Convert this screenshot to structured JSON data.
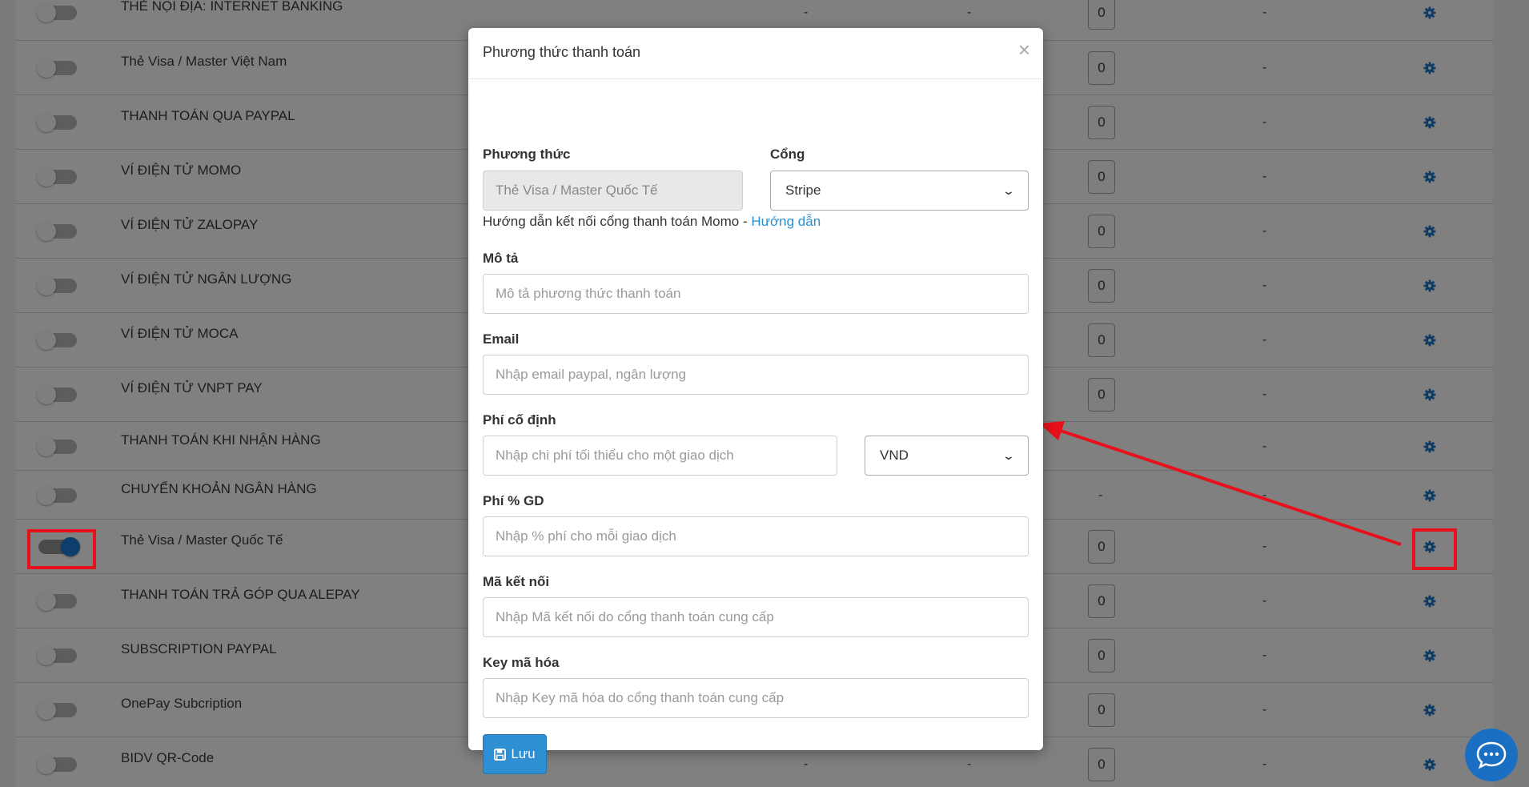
{
  "background": {
    "rows": [
      {
        "name": "THẺ NỘI ĐỊA: INTERNET BANKING",
        "col3": "-",
        "col4": "-",
        "box": "0",
        "col6": "-",
        "toggle_on": false
      },
      {
        "name": "Thẻ Visa / Master Việt Nam",
        "col3": "",
        "col4": "",
        "box": "0",
        "col6": "-",
        "toggle_on": false
      },
      {
        "name": "THANH TOÁN QUA PAYPAL",
        "col3": "",
        "col4": "",
        "box": "0",
        "col6": "-",
        "toggle_on": false
      },
      {
        "name": "VÍ ĐIỆN TỬ MOMO",
        "col3": "",
        "col4": "",
        "box": "0",
        "col6": "-",
        "toggle_on": false
      },
      {
        "name": "VÍ ĐIỆN TỬ ZALOPAY",
        "col3": "",
        "col4": "",
        "box": "0",
        "col6": "-",
        "toggle_on": false
      },
      {
        "name": "VÍ ĐIỆN TỬ NGÂN LƯỢNG",
        "col3": "",
        "col4": "",
        "box": "0",
        "col6": "-",
        "toggle_on": false
      },
      {
        "name": "VÍ ĐIỆN TỬ MOCA",
        "col3": "",
        "col4": "",
        "box": "0",
        "col6": "-",
        "toggle_on": false
      },
      {
        "name": "VÍ ĐIỆN TỬ VNPT PAY",
        "col3": "",
        "col4": "",
        "box": "0",
        "col6": "-",
        "toggle_on": false
      },
      {
        "name": "THANH TOÁN KHI NHẬN HÀNG",
        "col3": "",
        "col4": "",
        "box": "",
        "col6": "-",
        "toggle_on": false
      },
      {
        "name": "CHUYỂN KHOẢN NGÂN HÀNG",
        "col3": "",
        "col4": "",
        "box": "-",
        "col6": "-",
        "toggle_on": false
      },
      {
        "name": "Thẻ Visa / Master Quốc Tế",
        "col3": "",
        "col4": "",
        "box": "0",
        "col6": "-",
        "toggle_on": true
      },
      {
        "name": "THANH TOÁN TRẢ GÓP QUA ALEPAY",
        "col3": "",
        "col4": "",
        "box": "0",
        "col6": "-",
        "toggle_on": false
      },
      {
        "name": "SUBSCRIPTION PAYPAL",
        "col3": "",
        "col4": "",
        "box": "0",
        "col6": "-",
        "toggle_on": false
      },
      {
        "name": "OnePay Subcription",
        "col3": "",
        "col4": "",
        "box": "0",
        "col6": "-",
        "toggle_on": false
      },
      {
        "name": "BIDV QR-Code",
        "col3": "-",
        "col4": "-",
        "box": "0",
        "col6": "-",
        "toggle_on": false
      }
    ]
  },
  "modal": {
    "title": "Phương thức thanh toán",
    "close_symbol": "×",
    "method": {
      "label": "Phương thức",
      "value": "Thẻ Visa / Master Quốc Tế"
    },
    "gateway": {
      "label": "Cổng",
      "selected": "Stripe"
    },
    "help": {
      "text": "Hướng dẫn kết nối cổng thanh toán Momo - ",
      "link": "Hướng dẫn"
    },
    "description": {
      "label": "Mô tả",
      "placeholder": "Mô tả phương thức thanh toán"
    },
    "email": {
      "label": "Email",
      "placeholder": "Nhập email paypal, ngân lượng"
    },
    "fixed_fee": {
      "label": "Phí cố định",
      "placeholder": "Nhập chi phí tối thiểu cho một giao dịch",
      "currency": "VND"
    },
    "percent_fee": {
      "label": "Phí % GD",
      "placeholder": "Nhập % phí cho mỗi giao dịch"
    },
    "connect_code": {
      "label": "Mã kết nối",
      "placeholder": "Nhập Mã kết nối do cổng thanh toán cung cấp"
    },
    "encrypt_key": {
      "label": "Key mã hóa",
      "placeholder": "Nhập Key mã hóa do cổng thanh toán cung cấp"
    },
    "save_label": "Lưu"
  },
  "colors": {
    "primary": "#2f8fd3",
    "link": "#2a8fd0",
    "annotation": "#e6111a",
    "gear": "#0f3c63",
    "chat": "#1b6fc3"
  },
  "icons": [
    "gear-icon",
    "close-icon",
    "chevron-down-icon",
    "save-icon",
    "chat-icon"
  ]
}
